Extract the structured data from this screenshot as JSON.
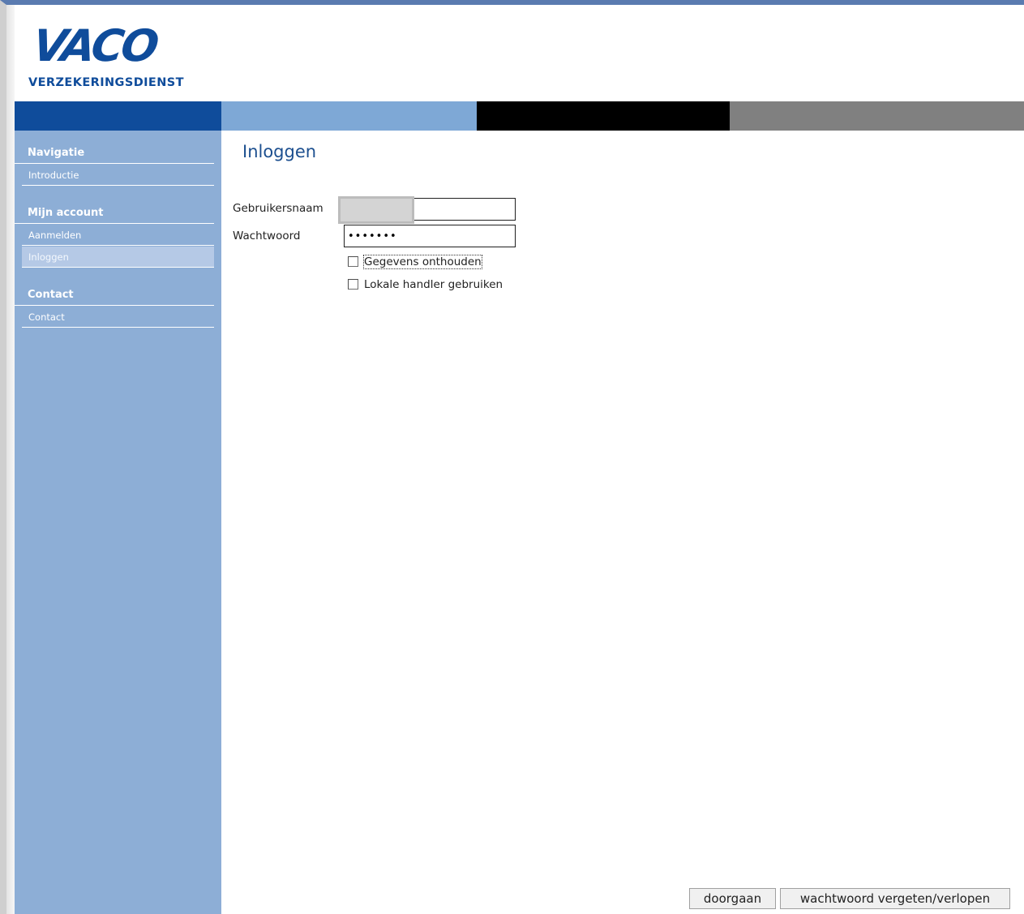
{
  "header": {
    "logo_text": "VACO",
    "logo_subtitle": "VERZEKERINGSDIENST"
  },
  "sidebar": {
    "groups": [
      {
        "heading": "Navigatie",
        "items": [
          {
            "label": "Introductie",
            "active": false
          }
        ]
      },
      {
        "heading": "Mijn account",
        "items": [
          {
            "label": "Aanmelden",
            "active": false
          },
          {
            "label": "Inloggen",
            "active": true
          }
        ]
      },
      {
        "heading": "Contact",
        "items": [
          {
            "label": "Contact",
            "active": false
          }
        ]
      }
    ]
  },
  "main": {
    "title": "Inloggen",
    "form": {
      "username_label": "Gebruikersnaam",
      "username_value": "",
      "password_label": "Wachtwoord",
      "password_value": "•••••••",
      "remember_label": "Gegevens onthouden",
      "remember_checked": false,
      "handler_label": "Lokale handler gebruiken",
      "handler_checked": false
    },
    "buttons": {
      "continue_label": "doorgaan",
      "forgot_label": "wachtwoord vergeten/verlopen"
    }
  },
  "colors": {
    "brand_blue": "#0f4c9b",
    "sidebar_blue": "#8daed6",
    "band_light_blue": "#7ea8d6",
    "band_black": "#000000",
    "band_gray": "#808080"
  }
}
